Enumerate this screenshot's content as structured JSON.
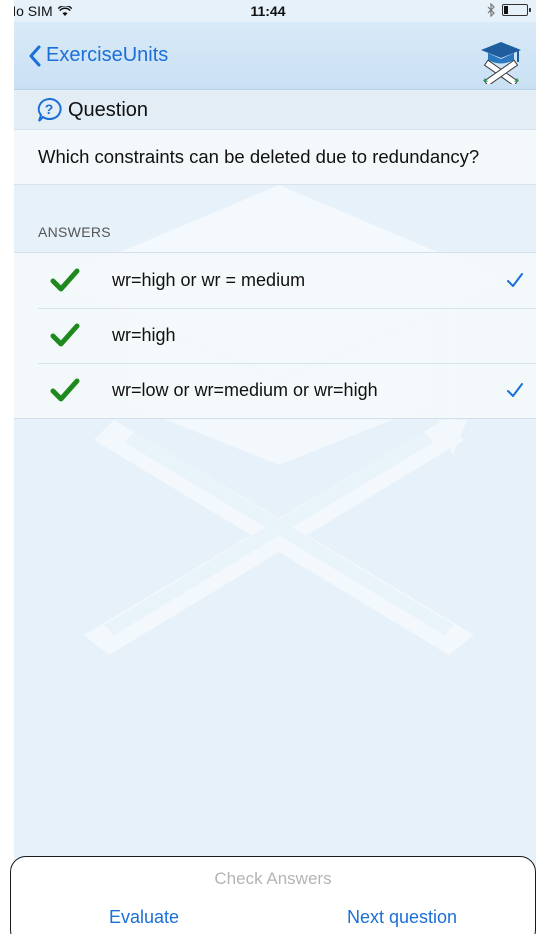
{
  "status_bar": {
    "carrier": "No SIM",
    "time": "11:44"
  },
  "nav": {
    "back_label": "ExerciseUnits",
    "logo_icon": "graduation-cap-pencils-icon"
  },
  "question": {
    "title": "Question",
    "text": "Which constraints can be deleted due to redundancy?"
  },
  "answers": {
    "header": "ANSWERS",
    "items": [
      {
        "text": "wr=high or wr = medium",
        "correct": true,
        "selected": true
      },
      {
        "text": "wr=high",
        "correct": true,
        "selected": false
      },
      {
        "text": "wr=low or wr=medium or wr=high",
        "correct": true,
        "selected": true
      }
    ]
  },
  "bottom": {
    "check_answers": "Check Answers",
    "evaluate": "Evaluate",
    "next_question": "Next question"
  },
  "colors": {
    "accent": "#1a6fd8",
    "correct": "#1e8a1e",
    "background": "#e6f1fa",
    "disabled": "#b4b4b4"
  }
}
